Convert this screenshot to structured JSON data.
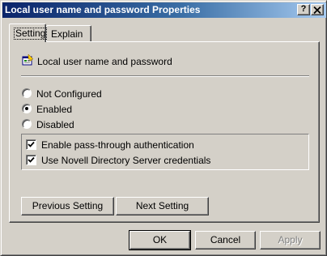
{
  "window": {
    "title": "Local user name and password Properties",
    "help_button": "?",
    "close_button": "×"
  },
  "tabs": [
    {
      "label": "Setting",
      "active": true
    },
    {
      "label": "Explain",
      "active": false
    }
  ],
  "policy": {
    "icon": "policy-setting-icon",
    "name": "Local user name and password"
  },
  "state_options": [
    {
      "label": "Not Configured",
      "selected": false
    },
    {
      "label": "Enabled",
      "selected": true
    },
    {
      "label": "Disabled",
      "selected": false
    }
  ],
  "checkboxes": [
    {
      "label": "Enable pass-through authentication",
      "checked": true
    },
    {
      "label": "Use Novell Directory Server credentials",
      "checked": true
    }
  ],
  "navigation": {
    "previous_label": "Previous Setting",
    "next_label": "Next Setting"
  },
  "footer": {
    "ok_label": "OK",
    "cancel_label": "Cancel",
    "apply_label": "Apply",
    "apply_enabled": false
  },
  "colors": {
    "title_gradient_start": "#0a246a",
    "title_gradient_end": "#a6caf0",
    "face": "#d4d0c8"
  }
}
